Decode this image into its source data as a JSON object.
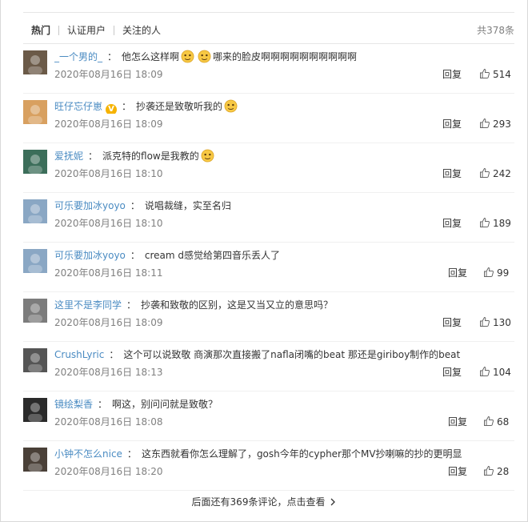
{
  "tabs": [
    {
      "label": "热门",
      "active": true
    },
    {
      "label": "认证用户",
      "active": false
    },
    {
      "label": "关注的人",
      "active": false
    }
  ],
  "total_count": "共378条",
  "reply_label": "回复",
  "comments": [
    {
      "user": "_一个男的_",
      "verified": false,
      "text_before": "他怎么这样啊",
      "emojis_mid": 2,
      "text_after": "哪来的脸皮啊啊啊啊啊啊啊啊啊啊",
      "time": "2020年08月16日 18:09",
      "likes": "514",
      "avatar_color": "#6b5a48"
    },
    {
      "user": "旺仔忘仔崽",
      "verified": true,
      "text_before": "抄袭还是致敬听我的",
      "emojis_end": 1,
      "time": "2020年08月16日 18:09",
      "likes": "293",
      "avatar_color": "#d8a060"
    },
    {
      "user": "爱抚妮",
      "verified": false,
      "text_before": "派克特的flow是我教的",
      "emojis_end": 1,
      "time": "2020年08月16日 18:10",
      "likes": "242",
      "avatar_color": "#3c6e5a"
    },
    {
      "user": "可乐要加冰yoyo",
      "verified": false,
      "text_before": "说唱裁缝，实至名归",
      "time": "2020年08月16日 18:10",
      "likes": "189",
      "avatar_color": "#8aa7c4"
    },
    {
      "user": "可乐要加冰yoyo",
      "verified": false,
      "text_before": "cream d感觉给第四音乐丢人了",
      "time": "2020年08月16日 18:11",
      "likes": "99",
      "avatar_color": "#8aa7c4"
    },
    {
      "user": "这里不是李同学",
      "verified": false,
      "text_before": "抄袭和致敬的区别，这是又当又立的意思吗？",
      "time": "2020年08月16日 18:09",
      "likes": "130",
      "avatar_color": "#7c7c7c"
    },
    {
      "user": "CrushLyric",
      "verified": false,
      "text_before": "这个可以说致敬 商演那次直接搬了nafla闭嘴的beat 那还是giriboy制作的beat",
      "time": "2020年08月16日 18:13",
      "likes": "104",
      "avatar_color": "#555555"
    },
    {
      "user": "镜绘梨香",
      "verified": false,
      "text_before": "啊这，别问问就是致敬？",
      "time": "2020年08月16日 18:08",
      "likes": "68",
      "avatar_color": "#2a2a2a"
    },
    {
      "user": "小钟不怎么nice",
      "verified": false,
      "text_before": "这东西就看你怎么理解了，gosh今年的cypher那个MV抄喇嘛的抄的更明显",
      "time": "2020年08月16日 18:20",
      "likes": "28",
      "avatar_color": "#4a4038"
    }
  ],
  "more_label": "后面还有369条评论，点击查看",
  "colors": {
    "link": "#4a8bc2",
    "muted": "#808080",
    "text": "#333333"
  },
  "icons": {
    "like": "thumb-up-icon",
    "more": "chevron-right-icon",
    "emoji": "emoji-icon",
    "verified": "verified-badge-icon"
  }
}
